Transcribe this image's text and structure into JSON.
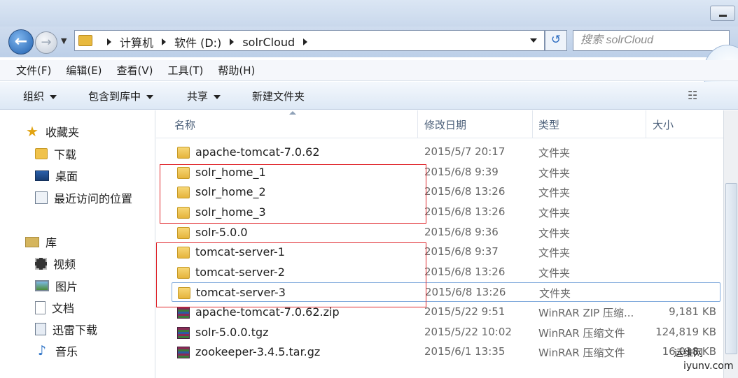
{
  "nav": {
    "breadcrumbs": [
      "计算机",
      "软件 (D:)",
      "solrCloud"
    ],
    "search_placeholder": "搜索 solrCloud"
  },
  "menu": [
    "文件(F)",
    "编辑(E)",
    "查看(V)",
    "工具(T)",
    "帮助(H)"
  ],
  "toolbar": {
    "organize": "组织",
    "include_in_library": "包含到库中",
    "share": "共享",
    "new_folder": "新建文件夹"
  },
  "sidebar": {
    "favorites": "收藏夹",
    "downloads": "下载",
    "desktop": "桌面",
    "recent": "最近访问的位置",
    "libraries": "库",
    "videos": "视频",
    "pictures": "图片",
    "documents": "文档",
    "thunder": "迅雷下载",
    "music": "音乐"
  },
  "columns": {
    "name": "名称",
    "date": "修改日期",
    "type": "类型",
    "size": "大小"
  },
  "files": [
    {
      "name": "apache-tomcat-7.0.62",
      "date": "2015/5/7 20:17",
      "type": "文件夹",
      "size": "",
      "icon": "folder-icon"
    },
    {
      "name": "solr_home_1",
      "date": "2015/6/8 9:39",
      "type": "文件夹",
      "size": "",
      "icon": "folder-icon"
    },
    {
      "name": "solr_home_2",
      "date": "2015/6/8 13:26",
      "type": "文件夹",
      "size": "",
      "icon": "folder-icon"
    },
    {
      "name": "solr_home_3",
      "date": "2015/6/8 13:26",
      "type": "文件夹",
      "size": "",
      "icon": "folder-icon"
    },
    {
      "name": "solr-5.0.0",
      "date": "2015/6/8 9:36",
      "type": "文件夹",
      "size": "",
      "icon": "folder-icon"
    },
    {
      "name": "tomcat-server-1",
      "date": "2015/6/8 9:37",
      "type": "文件夹",
      "size": "",
      "icon": "folder-icon"
    },
    {
      "name": "tomcat-server-2",
      "date": "2015/6/8 13:26",
      "type": "文件夹",
      "size": "",
      "icon": "folder-icon"
    },
    {
      "name": "tomcat-server-3",
      "date": "2015/6/8 13:26",
      "type": "文件夹",
      "size": "",
      "icon": "folder-icon"
    },
    {
      "name": "apache-tomcat-7.0.62.zip",
      "date": "2015/5/22 9:51",
      "type": "WinRAR ZIP 压缩...",
      "size": "9,181 KB",
      "icon": "winrar-icon"
    },
    {
      "name": "solr-5.0.0.tgz",
      "date": "2015/5/22 10:02",
      "type": "WinRAR 压缩文件",
      "size": "124,819 KB",
      "icon": "winrar-icon"
    },
    {
      "name": "zookeeper-3.4.5.tar.gz",
      "date": "2015/6/1 13:35",
      "type": "WinRAR 压缩文件",
      "size": "16,018 KB",
      "icon": "winrar-icon"
    }
  ],
  "watermark": {
    "line1": "运维网",
    "line2": "iyunv.com"
  },
  "colors": {
    "highlight_box": "#e0262b",
    "selection_border": "#84acdd"
  }
}
